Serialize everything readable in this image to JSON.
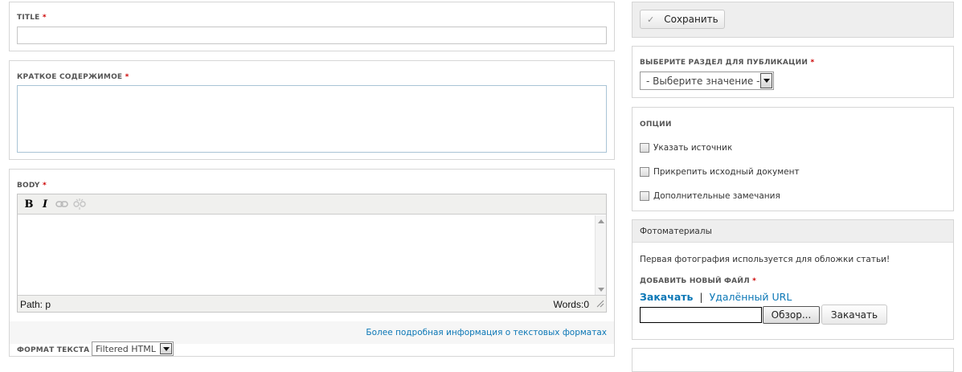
{
  "title_field": {
    "label": "TITLE",
    "required": "*",
    "value": ""
  },
  "summary_field": {
    "label": "КРАТКОЕ СОДЕРЖИМОЕ",
    "required": "*",
    "value": ""
  },
  "body_field": {
    "label": "BODY",
    "required": "*",
    "toolbar": {
      "bold": "B",
      "italic": "I"
    },
    "path": "Path: p",
    "words": "Words:0",
    "format_help_link": "Более подробная информация о текстовых форматах",
    "format_label": "ФОРМАТ ТЕКСТА",
    "format_value": "Filtered HTML"
  },
  "save": {
    "label": "Сохранить",
    "icon": "check-icon"
  },
  "section": {
    "label": "ВЫБЕРИТЕ РАЗДЕЛ ДЛЯ ПУБЛИКАЦИИ",
    "required": "*",
    "select_value": "- Выберите значение -"
  },
  "options": {
    "title": "ОПЦИИ",
    "items": [
      {
        "label": "Указать источник"
      },
      {
        "label": "Прикрепить исходный документ"
      },
      {
        "label": "Дополнительные замечания"
      }
    ]
  },
  "photos": {
    "title": "Фотоматериалы",
    "description": "Первая фотография используется для обложки статьи!",
    "add_label": "ДОБАВИТЬ НОВЫЙ ФАЙЛ",
    "required": "*",
    "tab_upload": "Закачать",
    "separator": "|",
    "tab_remote": "Удалённый URL",
    "browse_label": "Обзор...",
    "upload_label": "Закачать"
  }
}
